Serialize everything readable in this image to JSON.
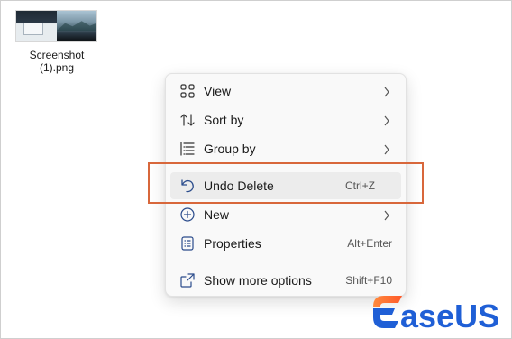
{
  "desktop": {
    "file_icon": {
      "label": "Screenshot\n(1).png",
      "name": "image-file-icon"
    }
  },
  "context_menu": {
    "items": [
      {
        "label": "View",
        "icon": "grid-view-icon",
        "submenu": true
      },
      {
        "label": "Sort by",
        "icon": "sort-icon",
        "submenu": true
      },
      {
        "label": "Group by",
        "icon": "group-list-icon",
        "submenu": true
      },
      {
        "label": "Undo Delete",
        "icon": "undo-icon",
        "shortcut": "Ctrl+Z",
        "highlighted": true
      },
      {
        "label": "New",
        "icon": "plus-circle-icon",
        "submenu": true
      },
      {
        "label": "Properties",
        "icon": "properties-icon",
        "shortcut": "Alt+Enter"
      },
      {
        "label": "Show more options",
        "icon": "share-box-icon",
        "shortcut": "Shift+F10"
      }
    ]
  },
  "annotation": {
    "color": "#d8673b"
  },
  "branding": {
    "logo_text": "EaseUS",
    "colors": {
      "blue": "#1f5fd6",
      "orange": "#ff6a2e"
    }
  }
}
